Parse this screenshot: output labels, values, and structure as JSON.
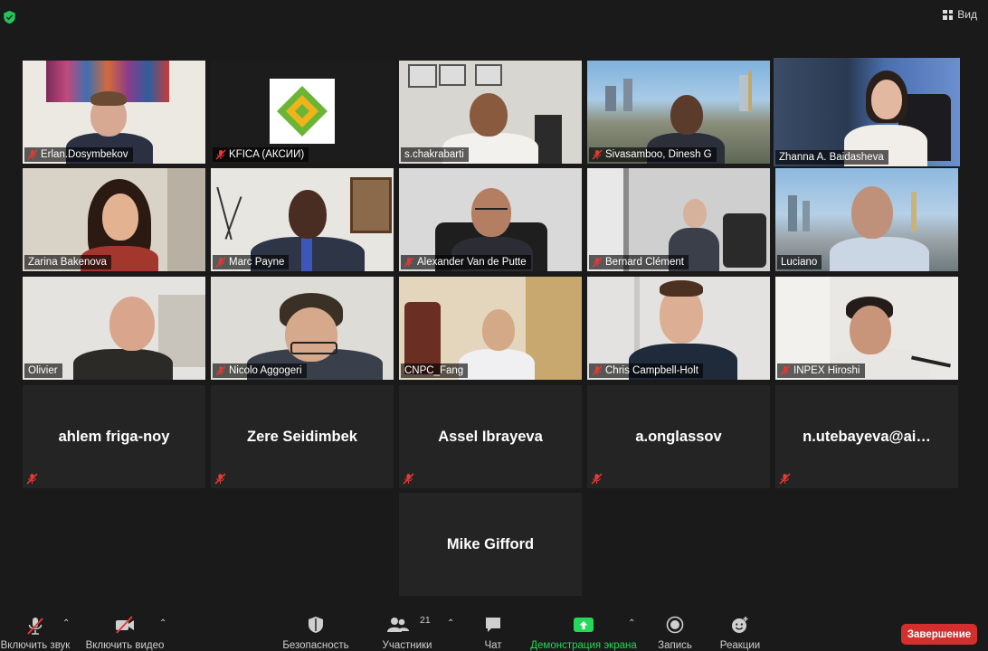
{
  "topbar": {
    "view_label": "Вид"
  },
  "participants": [
    {
      "name": "Erlan.Dosymbekov",
      "muted": true
    },
    {
      "name": "KFICA (АКСИИ)",
      "muted": true
    },
    {
      "name": "s.chakrabarti",
      "muted": false
    },
    {
      "name": "Sivasamboo, Dinesh G",
      "muted": true
    },
    {
      "name": "Zhanna A. Baidasheva",
      "muted": false
    },
    {
      "name": "Zarina Bakenova",
      "muted": false
    },
    {
      "name": "Marc Payne",
      "muted": true
    },
    {
      "name": "Alexander Van de Putte",
      "muted": true
    },
    {
      "name": "Bernard Clément",
      "muted": true
    },
    {
      "name": "Luciano",
      "muted": false
    },
    {
      "name": "Olivier",
      "muted": false
    },
    {
      "name": "Nicolo Aggogeri",
      "muted": true
    },
    {
      "name": "CNPC_Fang",
      "muted": false
    },
    {
      "name": "Chris Campbell-Holt",
      "muted": true
    },
    {
      "name": "INPEX Hiroshi",
      "muted": true
    },
    {
      "name": "ahlem friga-noy",
      "muted": true
    },
    {
      "name": "Zere Seidimbek",
      "muted": true
    },
    {
      "name": "Assel Ibrayeva",
      "muted": true
    },
    {
      "name": "a.onglassov",
      "muted": true
    },
    {
      "name": "n.utebayeva@ai…",
      "muted": true
    },
    {
      "name": "Mike Gifford",
      "muted": false
    }
  ],
  "toolbar": {
    "audio_label": "Включить звук",
    "video_label": "Включить видео",
    "security_label": "Безопасность",
    "participants_label": "Участники",
    "participants_count": "21",
    "chat_label": "Чат",
    "share_label": "Демонстрация экрана",
    "record_label": "Запись",
    "reactions_label": "Реакции",
    "end_label": "Завершение"
  },
  "colors": {
    "background": "#1a1a1a",
    "tile": "#242424",
    "active_speaker": "#d9e96b",
    "share_green": "#23d959",
    "end_red": "#d32f2f",
    "muted_red": "#e53935"
  }
}
